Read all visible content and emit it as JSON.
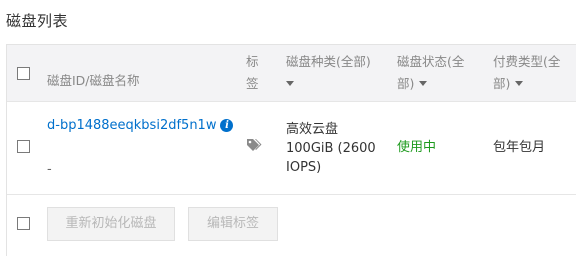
{
  "page": {
    "title": "磁盘列表"
  },
  "table": {
    "headers": {
      "name": "磁盘ID/磁盘名称",
      "tag_line1": "标",
      "tag_line2": "签",
      "type_line1": "磁盘种类(全部)",
      "type_line2": "",
      "status_line1": "磁盘状态(全",
      "status_line2": "部)",
      "pay_line1": "付费类型(全",
      "pay_line2": "部)"
    },
    "rows": [
      {
        "disk_id": "d-bp1488eeqkbsi2df5n1w",
        "disk_name": "-",
        "type_line1": "高效云盘",
        "type_line2": "100GiB (2600",
        "type_line3": "IOPS)",
        "status": "使用中",
        "pay_type": "包年包月"
      }
    ],
    "footer": {
      "reinit_button": "重新初始化磁盘",
      "edit_tags_button": "编辑标签"
    }
  },
  "colors": {
    "link": "#0070cc",
    "status_ok": "#1e9a1e",
    "header_bg": "#f3f3f5",
    "disabled_text": "#b8b8b8"
  },
  "icons": {
    "info": "info-icon",
    "tag": "tag-icon",
    "sort": "caret-down-icon"
  }
}
